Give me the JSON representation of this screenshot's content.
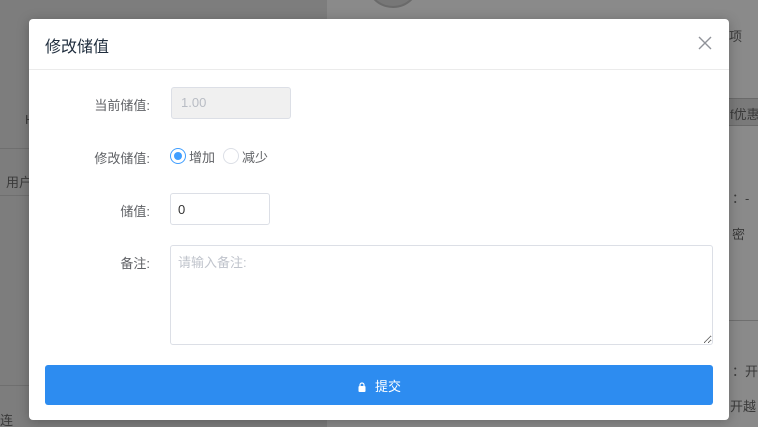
{
  "background": {
    "left_texts": [
      "H",
      "用户",
      "连"
    ],
    "right_texts": [
      "项",
      "f优惠",
      "：-",
      "密",
      "：开",
      "开越"
    ]
  },
  "modal": {
    "title": "修改储值",
    "close_icon": "close-icon"
  },
  "form": {
    "current_label": "当前储值:",
    "current_value": "1.00",
    "modify_label": "修改储值:",
    "radio_options": [
      "增加",
      "减少"
    ],
    "selected_option": "增加",
    "value_label": "储值:",
    "value": "0",
    "remark_label": "备注:",
    "remark_placeholder": "请输入备注:"
  },
  "submit": {
    "label": "提交",
    "icon": "lock-icon"
  },
  "colors": {
    "primary": "#2d8cf0",
    "radio_checked": "#409eff"
  }
}
